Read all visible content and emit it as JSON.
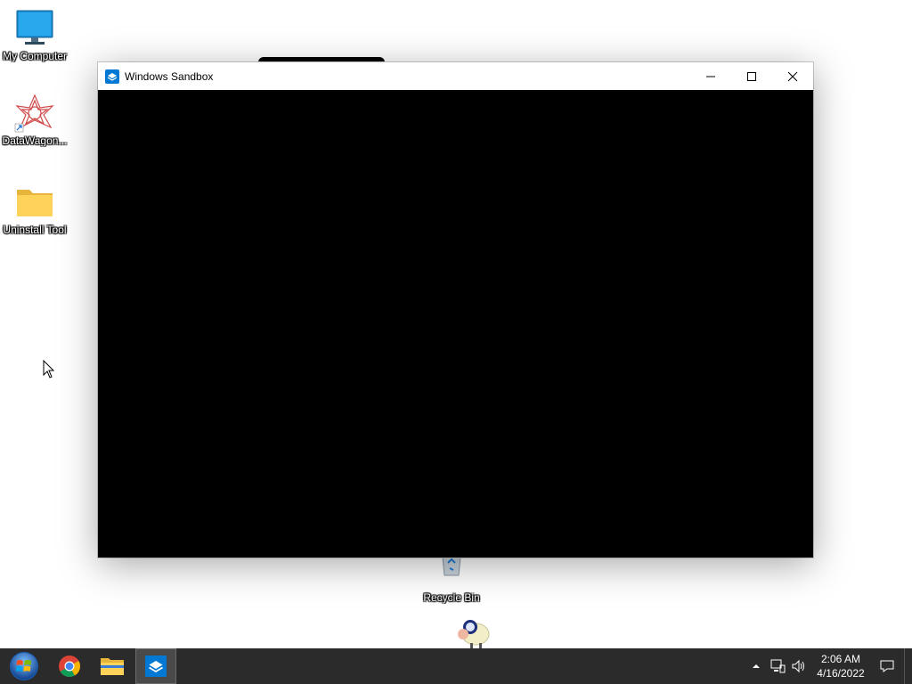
{
  "desktop": {
    "icons": [
      {
        "label": "My Computer",
        "icon": "monitor-icon"
      },
      {
        "label": "DataWagon...",
        "icon": "datawagon-icon"
      },
      {
        "label": "Uninstall Tool",
        "icon": "folder-icon"
      },
      {
        "label": "Recycle Bin",
        "icon": "recycle-bin-icon"
      }
    ]
  },
  "window": {
    "title": "Windows Sandbox",
    "icon": "sandbox-icon",
    "controls": [
      "minimize-icon",
      "maximize-icon",
      "close-icon"
    ],
    "content_color": "#000000"
  },
  "taskbar": {
    "apps": [
      {
        "name": "Start",
        "icon": "windows-start-icon"
      },
      {
        "name": "Google Chrome",
        "icon": "chrome-icon"
      },
      {
        "name": "File Explorer",
        "icon": "folder-icon"
      },
      {
        "name": "Windows Sandbox",
        "icon": "sandbox-icon",
        "active": true
      }
    ],
    "tray": {
      "icons": [
        "chevron-up-icon",
        "network-icon",
        "volume-icon",
        "notification-icon"
      ],
      "time": "2:06 AM",
      "date": "4/16/2022"
    }
  },
  "colors": {
    "taskbar": "#2b2b2b",
    "window_content": "#000000",
    "sandbox_accent": "#0078d4"
  }
}
